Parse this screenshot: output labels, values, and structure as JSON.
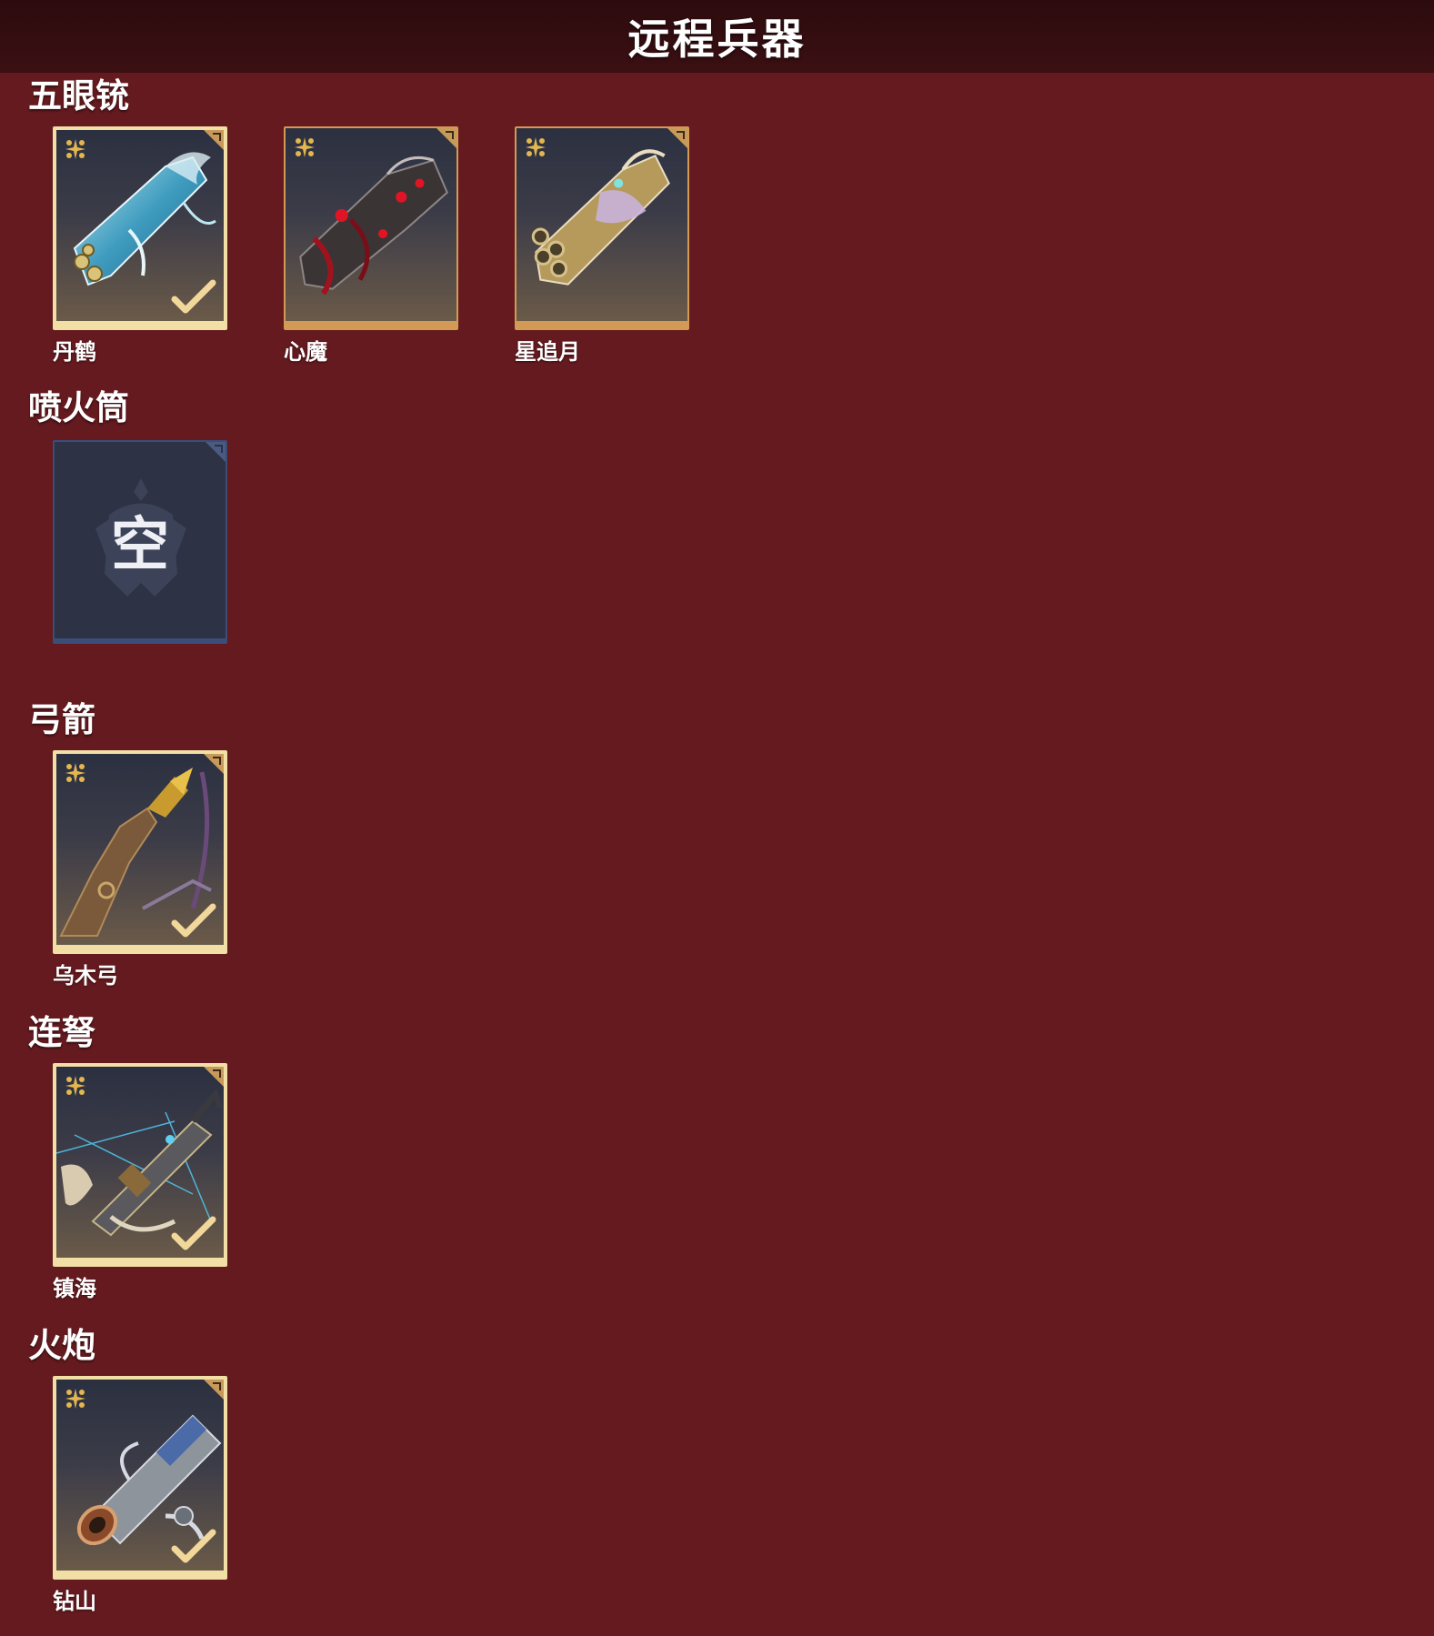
{
  "header": {
    "title": "远程兵器"
  },
  "sections": [
    {
      "title": "五眼铳",
      "items": [
        {
          "label": "丹鹤",
          "owned": true,
          "art": "blue-white multi-barrel gun"
        },
        {
          "label": "心魔",
          "owned": false,
          "art": "dark red demonic gun"
        },
        {
          "label": "星追月",
          "owned": false,
          "art": "golden purple multi-barrel gun"
        }
      ]
    },
    {
      "title": "喷火筒",
      "items": [
        {
          "label": "",
          "empty": true,
          "empty_text": "空"
        }
      ]
    },
    {
      "title": "弓箭",
      "items": [
        {
          "label": "乌木弓",
          "owned": true,
          "art": "wooden gold-flame bow"
        }
      ]
    },
    {
      "title": "连弩",
      "items": [
        {
          "label": "镇海",
          "owned": true,
          "art": "blue-string repeating crossbow"
        }
      ]
    },
    {
      "title": "火炮",
      "items": [
        {
          "label": "钻山",
          "owned": true,
          "art": "silver-blue cannon"
        }
      ]
    }
  ],
  "icons": {
    "rarity": "four-point-star-icon",
    "equipped": "check-icon",
    "corner": "corner-tab-icon"
  },
  "colors": {
    "background": "#641a1f",
    "header": "#2c0b0e",
    "owned_frame": "#f2dfa6",
    "unowned_frame": "#d29a55",
    "empty_frame": "#3a4e78"
  }
}
